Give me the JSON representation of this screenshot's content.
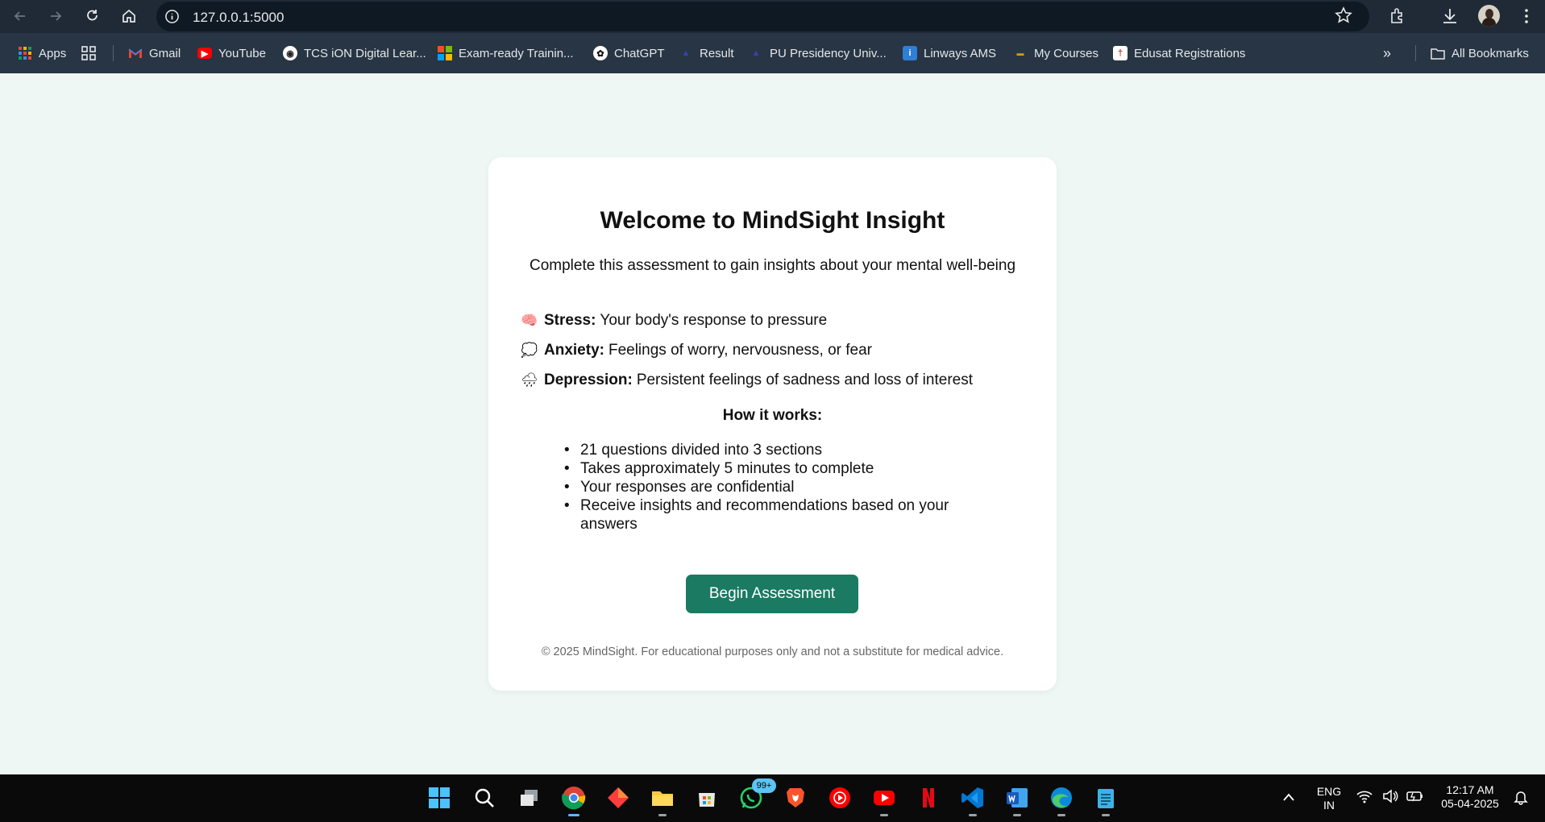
{
  "browser": {
    "url": "127.0.0.1:5000",
    "bookmarks": [
      {
        "label": "Apps",
        "icon": "apps-grid-icon"
      },
      {
        "label": "",
        "icon": "tab-groups-icon"
      },
      {
        "label": "Gmail",
        "icon": "gmail-icon"
      },
      {
        "label": "YouTube",
        "icon": "youtube-icon"
      },
      {
        "label": "TCS iON Digital Lear...",
        "icon": "tcs-icon"
      },
      {
        "label": "Exam-ready Trainin...",
        "icon": "microsoft-icon"
      },
      {
        "label": "ChatGPT",
        "icon": "chatgpt-icon"
      },
      {
        "label": "Result",
        "icon": "result-icon"
      },
      {
        "label": "PU Presidency Univ...",
        "icon": "pu-icon"
      },
      {
        "label": "Linways AMS",
        "icon": "linways-icon"
      },
      {
        "label": "My Courses",
        "icon": "courses-icon"
      },
      {
        "label": "Edusat Registrations",
        "icon": "edusat-icon"
      }
    ],
    "all_bookmarks": "All Bookmarks"
  },
  "page": {
    "title": "Welcome to MindSight Insight",
    "subtitle": "Complete this assessment to gain insights about your mental well-being",
    "definitions": [
      {
        "emoji": "🧠",
        "term": "Stress:",
        "desc": "Your body's response to pressure"
      },
      {
        "emoji": "💭",
        "term": "Anxiety:",
        "desc": "Feelings of worry, nervousness, or fear"
      },
      {
        "emoji": "🌧",
        "term": "Depression:",
        "desc": "Persistent feelings of sadness and loss of interest"
      }
    ],
    "how_title": "How it works:",
    "how_items": [
      "21 questions divided into 3 sections",
      "Takes approximately 5 minutes to complete",
      "Your responses are confidential",
      "Receive insights and recommendations based on your answers"
    ],
    "button": "Begin Assessment",
    "footer": "© 2025 MindSight. For educational purposes only and not a substitute for medical advice."
  },
  "taskbar": {
    "whatsapp_badge": "99+",
    "lang_line1": "ENG",
    "lang_line2": "IN",
    "time": "12:17 AM",
    "date": "05-04-2025"
  },
  "colors": {
    "page_bg": "#eff7f5",
    "accent": "#1a7a62",
    "topbar": "#1f2a36"
  }
}
